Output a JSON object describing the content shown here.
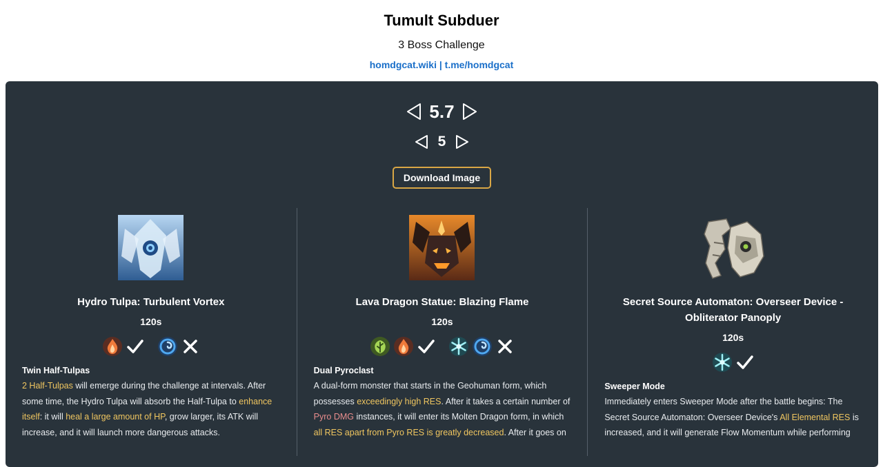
{
  "header": {
    "title": "Tumult Subduer",
    "subtitle": "3 Boss Challenge",
    "link_wiki": "homdgcat.wiki",
    "link_sep": " | ",
    "link_tg": "t.me/homdgcat"
  },
  "nav": {
    "version": "5.7",
    "stage": "5"
  },
  "download_label": "Download Image",
  "colors": {
    "panel": "#29333b",
    "highlight_yellow": "#f0c660",
    "highlight_pink": "#e88d8d",
    "link": "#1a6fc9",
    "button_border": "#d9a745"
  },
  "bosses": [
    {
      "name": "Hydro Tulpa: Turbulent Vortex",
      "time": "120s",
      "elements_good": [
        "pyro-icon"
      ],
      "elements_bad": [
        "hydro-icon"
      ],
      "mechanic_title": "Twin Half-Tulpas",
      "mechanic_parts": [
        {
          "t": "2 Half-Tulpas",
          "h": "y"
        },
        {
          "t": " will emerge during the challenge at intervals. After some time, the Hydro Tulpa will absorb the Half-Tulpa to "
        },
        {
          "t": "enhance itself",
          "h": "y"
        },
        {
          "t": ": it will "
        },
        {
          "t": "heal a large amount of HP",
          "h": "y"
        },
        {
          "t": ", grow larger, its ATK will increase, and it will launch more dangerous attacks."
        }
      ]
    },
    {
      "name": "Lava Dragon Statue: Blazing Flame",
      "time": "120s",
      "elements_good": [
        "dendro-icon",
        "pyro-icon"
      ],
      "elements_bad": [
        "cryo-icon",
        "hydro-icon"
      ],
      "mechanic_title": "Dual Pyroclast",
      "mechanic_parts": [
        {
          "t": "A dual-form monster that starts in the Geohuman form, which possesses "
        },
        {
          "t": "exceedingly high RES",
          "h": "y"
        },
        {
          "t": ". After it takes a certain number of "
        },
        {
          "t": "Pyro DMG",
          "h": "p"
        },
        {
          "t": " instances, it will enter its Molten Dragon form, in which "
        },
        {
          "t": "all RES apart from Pyro RES is greatly decreased",
          "h": "y"
        },
        {
          "t": ". After it goes on"
        }
      ]
    },
    {
      "name": "Secret Source Automaton: Overseer Device - Obliterator Panoply",
      "time": "120s",
      "elements_good": [
        "cryo-icon"
      ],
      "elements_bad": [],
      "mechanic_title": "Sweeper Mode",
      "mechanic_parts": [
        {
          "t": "Immediately enters Sweeper Mode after the battle begins: The Secret Source Automaton: Overseer Device's "
        },
        {
          "t": "All Elemental RES",
          "h": "y"
        },
        {
          "t": " is increased, and it will generate Flow Momentum while performing"
        }
      ]
    }
  ]
}
